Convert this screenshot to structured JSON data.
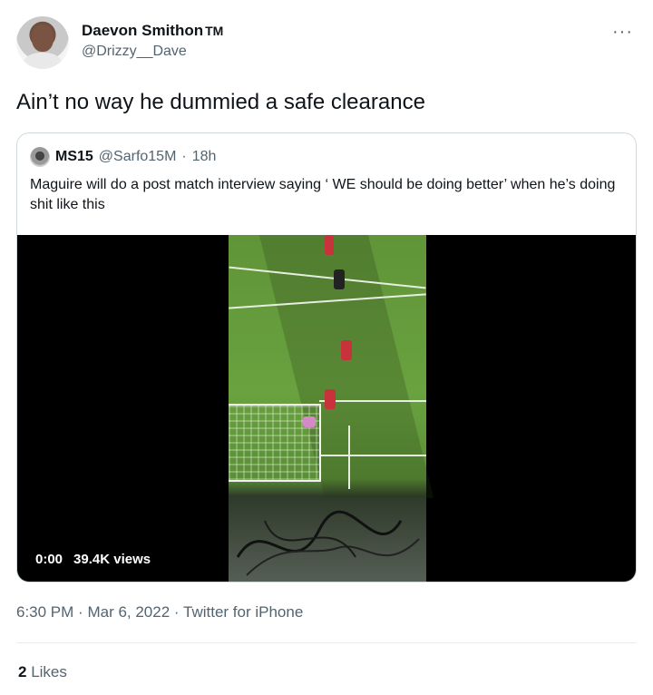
{
  "author": {
    "display_name": "Daevon Smithon",
    "name_suffix": "TM",
    "handle": "@Drizzy__Dave",
    "avatar_icon": "profile-photo"
  },
  "more_icon": "···",
  "tweet": {
    "text": "Ain’t no way he dummied a safe clearance"
  },
  "quote": {
    "display_name": "MS15",
    "handle": "@Sarfo15M",
    "separator": "·",
    "time": "18h",
    "text": "Maguire will do a post match interview saying ‘ WE should be doing better’ when he’s doing shit like this"
  },
  "video": {
    "time": "0:00",
    "views": "39.4K views"
  },
  "meta": {
    "time": "6:30 PM",
    "sep1": "·",
    "date": "Mar 6, 2022",
    "sep2": "·",
    "source": "Twitter for iPhone"
  },
  "likes": {
    "count": "2",
    "label": "Likes"
  },
  "colors": {
    "text_primary": "#0f1419",
    "text_secondary": "#536471",
    "border": "#cfd9de"
  }
}
